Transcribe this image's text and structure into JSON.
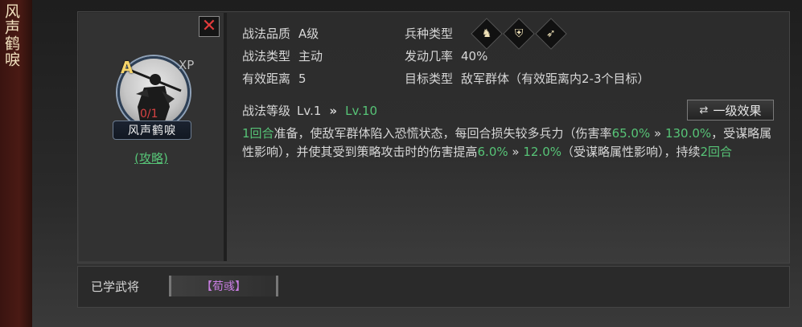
{
  "side_title": "风声鹤唳",
  "skill": {
    "grade": "A",
    "xp_label": "XP",
    "count": "0/1",
    "name": "风声鹤唳",
    "guide_link": "(攻略)"
  },
  "info": {
    "quality_label": "战法品质",
    "quality_value": "A级",
    "skill_type_label": "战法类型",
    "skill_type_value": "主动",
    "range_label": "有效距离",
    "range_value": "5",
    "troop_type_label": "兵种类型",
    "troop_icons": [
      "cavalry-icon",
      "shield-icon",
      "bow-icon"
    ],
    "trigger_rate_label": "发动几率",
    "trigger_rate_value": "40%",
    "target_label": "目标类型",
    "target_value": "敌军群体（有效距离内2-3个目标）"
  },
  "level": {
    "label": "战法等级",
    "current": "Lv.1",
    "arrow": "»",
    "max": "Lv.10",
    "effect_button": "一级效果",
    "effect_icon": "⇄"
  },
  "description": {
    "p1": "1回合",
    "p2": "准备，使敌军群体陷入恐慌状态，每回合损失较多兵力（伤害率",
    "p3": "65.0%",
    "p4": " » ",
    "p5": "130.0%",
    "p6": "，受谋略属性影响），并使其受到策略攻击时的伤害提高",
    "p7": "6.0%",
    "p8": " » ",
    "p9": "12.0%",
    "p10": "（受谋略属性影响），持续",
    "p11": "2回合"
  },
  "learned": {
    "label": "已学武将",
    "general": "【荀彧】"
  },
  "colors": {
    "green": "#57c477",
    "red": "#d94343",
    "purple": "#c77de0",
    "gold": "#f4d36a"
  }
}
